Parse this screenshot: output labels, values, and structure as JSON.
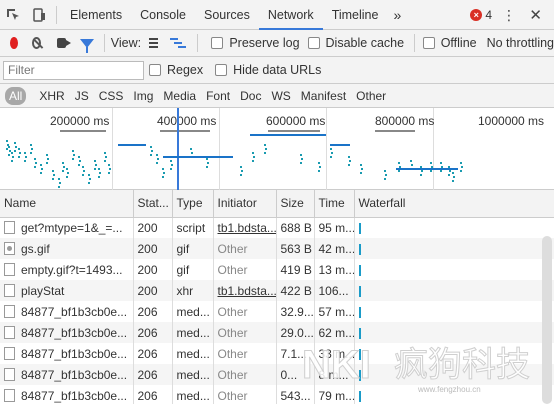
{
  "tabbar": {
    "tabs": [
      "Elements",
      "Console",
      "Sources",
      "Network",
      "Timeline"
    ],
    "active_tab": "Network",
    "more_label": "»",
    "error_count": "4"
  },
  "toolbar": {
    "view_label": "View:",
    "preserve_log": "Preserve log",
    "disable_cache": "Disable cache",
    "offline": "Offline",
    "throttle": "No throttling"
  },
  "filter": {
    "placeholder": "Filter",
    "regex": "Regex",
    "hide_data_urls": "Hide data URLs"
  },
  "types": [
    "All",
    "XHR",
    "JS",
    "CSS",
    "Img",
    "Media",
    "Font",
    "Doc",
    "WS",
    "Manifest",
    "Other"
  ],
  "active_type": "All",
  "overview": {
    "ticks": [
      "200000 ms",
      "400000 ms",
      "600000 ms",
      "800000 ms",
      "1000000 ms"
    ]
  },
  "table": {
    "columns": [
      "Name",
      "Stat...",
      "Type",
      "Initiator",
      "Size",
      "Time",
      "Waterfall"
    ],
    "rows": [
      {
        "name": "get?mtype=1&_=...",
        "status": "200",
        "type": "script",
        "initiator": "tb1.bdsta...",
        "size": "688 B",
        "time": "95 m...",
        "icon": "file"
      },
      {
        "name": "gs.gif",
        "status": "200",
        "type": "gif",
        "initiator": "Other",
        "size": "563 B",
        "time": "42 m...",
        "icon": "image"
      },
      {
        "name": "empty.gif?t=1493...",
        "status": "200",
        "type": "gif",
        "initiator": "Other",
        "size": "419 B",
        "time": "13 m...",
        "icon": "file"
      },
      {
        "name": "playStat",
        "status": "200",
        "type": "xhr",
        "initiator": "tb1.bdsta...",
        "size": "422 B",
        "time": "106...",
        "icon": "file"
      },
      {
        "name": "84877_bf1b3cb0e...",
        "status": "206",
        "type": "med...",
        "initiator": "Other",
        "size": "32.9...",
        "time": "57 m...",
        "icon": "file"
      },
      {
        "name": "84877_bf1b3cb0e...",
        "status": "206",
        "type": "med...",
        "initiator": "Other",
        "size": "29.0...",
        "time": "62 m...",
        "icon": "file"
      },
      {
        "name": "84877_bf1b3cb0e...",
        "status": "206",
        "type": "med...",
        "initiator": "Other",
        "size": "7.1...",
        "time": "33 m...",
        "icon": "file"
      },
      {
        "name": "84877_bf1b3cb0e...",
        "status": "206",
        "type": "med...",
        "initiator": "Other",
        "size": "0...",
        "time": "8 m...",
        "icon": "file"
      },
      {
        "name": "84877_bf1b3cb0e...",
        "status": "206",
        "type": "med...",
        "initiator": "Other",
        "size": "543...",
        "time": "79 m...",
        "icon": "file"
      }
    ]
  },
  "watermark": {
    "logo": "NKI",
    "text": "疯狗科技",
    "sub": "www.fengzhou.cn"
  }
}
